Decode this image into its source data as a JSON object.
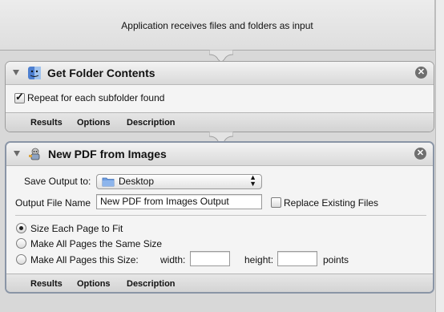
{
  "input_header": {
    "text": "Application receives files and folders as input"
  },
  "actions": [
    {
      "title": "Get Folder Contents",
      "icon": "finder-icon",
      "options": {
        "repeat_label": "Repeat for each subfolder found",
        "repeat_checked": true
      },
      "footer": [
        "Results",
        "Options",
        "Description"
      ]
    },
    {
      "title": "New PDF from Images",
      "icon": "automator-robot-icon",
      "save_output_label": "Save Output to:",
      "save_output_value": "Desktop",
      "output_name_label": "Output File Name",
      "output_name_value": "New PDF from Images Output",
      "replace_label": "Replace Existing Files",
      "replace_checked": false,
      "radio_options": [
        {
          "label": "Size Each Page to Fit",
          "checked": true
        },
        {
          "label": "Make All Pages the Same Size",
          "checked": false
        },
        {
          "label": "Make All Pages this Size:",
          "checked": false
        }
      ],
      "width_label": "width:",
      "height_label": "height:",
      "units_label": "points",
      "footer": [
        "Results",
        "Options",
        "Description"
      ]
    }
  ],
  "colors": {
    "accent_selected_border": "#8a95a6",
    "folder_blue": "#5a8ed8"
  }
}
